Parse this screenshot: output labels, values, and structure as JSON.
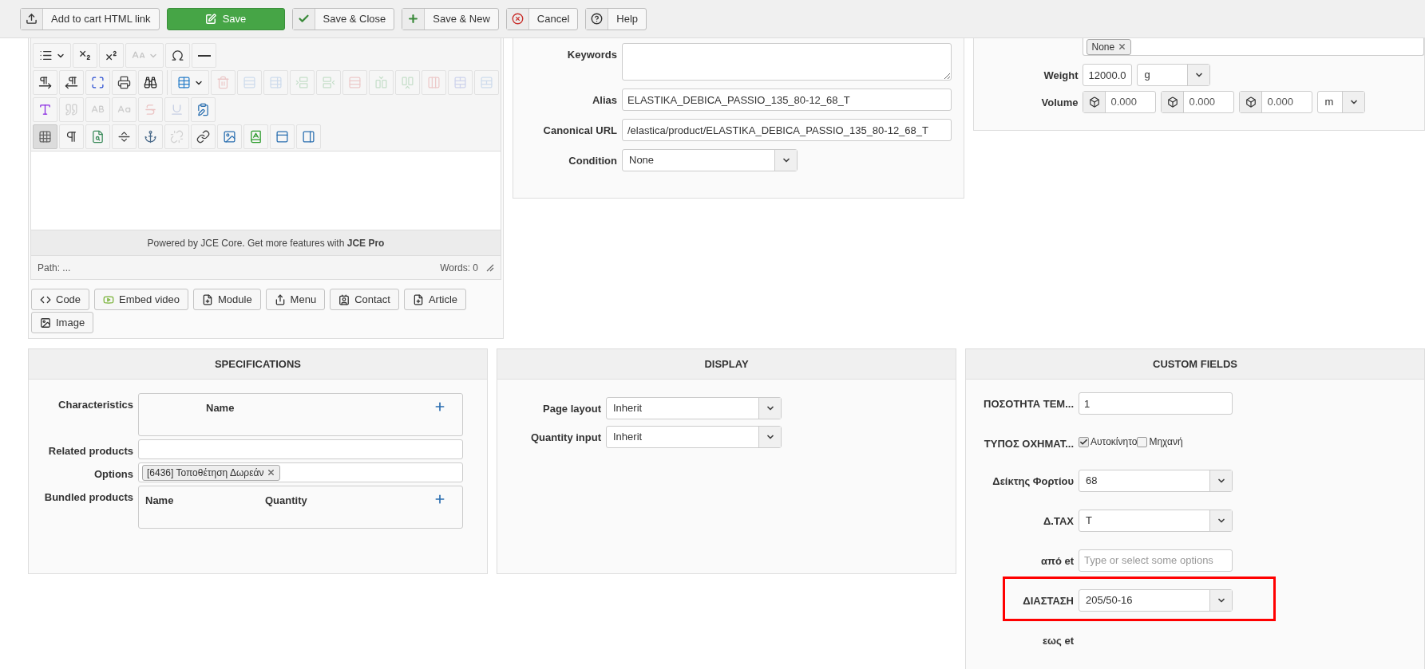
{
  "toolbar": {
    "buttons": [
      {
        "label": "Add to cart HTML link",
        "kind": "upload"
      },
      {
        "label": "Save",
        "kind": "save"
      },
      {
        "label": "Save & Close",
        "kind": "check"
      },
      {
        "label": "Save & New",
        "kind": "plus"
      },
      {
        "label": "Cancel",
        "kind": "cancel"
      },
      {
        "label": "Help",
        "kind": "help"
      }
    ]
  },
  "editor": {
    "toolbar_rows": [
      {
        "groups": [
          [
            {
              "kind": "bullet-list",
              "dropdown": true,
              "disabled": false,
              "selected": false
            },
            {
              "kind": "subscript",
              "disabled": false,
              "selected": false
            },
            {
              "kind": "superscript",
              "disabled": false,
              "selected": false
            },
            {
              "kind": "font-size",
              "dropdown": true,
              "disabled": true,
              "selected": false
            },
            {
              "kind": "special-char",
              "disabled": false,
              "selected": false
            },
            {
              "kind": "horizontal-rule",
              "disabled": false,
              "selected": false
            }
          ]
        ]
      },
      {
        "groups": [
          [
            {
              "kind": "ltr",
              "disabled": false,
              "selected": false
            },
            {
              "kind": "rtl",
              "disabled": false,
              "selected": false
            },
            {
              "kind": "fullscreen",
              "disabled": false,
              "selected": false
            },
            {
              "kind": "print",
              "disabled": false,
              "selected": false
            },
            {
              "kind": "search",
              "disabled": false,
              "selected": false
            }
          ],
          [
            {
              "kind": "table",
              "dropdown": true,
              "disabled": false,
              "selected": false
            },
            {
              "kind": "delete-table",
              "disabled": true,
              "selected": false
            },
            {
              "kind": "row-props",
              "disabled": true,
              "selected": false
            },
            {
              "kind": "cell-props",
              "disabled": true,
              "selected": false
            },
            {
              "kind": "row-before",
              "disabled": true,
              "selected": false
            },
            {
              "kind": "row-after",
              "disabled": true,
              "selected": false
            },
            {
              "kind": "delete-row",
              "disabled": true,
              "selected": false
            },
            {
              "kind": "col-before",
              "disabled": true,
              "selected": false
            },
            {
              "kind": "col-after",
              "disabled": true,
              "selected": false
            },
            {
              "kind": "delete-col",
              "disabled": true,
              "selected": false
            },
            {
              "kind": "merge-cells",
              "disabled": true,
              "selected": false
            },
            {
              "kind": "split-cells",
              "disabled": true,
              "selected": false
            }
          ]
        ]
      },
      {
        "groups": [
          [
            {
              "kind": "style",
              "disabled": false,
              "selected": false
            },
            {
              "kind": "quote",
              "disabled": true,
              "selected": false
            },
            {
              "kind": "abbr",
              "disabled": true,
              "selected": false
            },
            {
              "kind": "acronym",
              "disabled": true,
              "selected": false
            },
            {
              "kind": "del",
              "disabled": true,
              "selected": false
            },
            {
              "kind": "ins",
              "disabled": true,
              "selected": false
            },
            {
              "kind": "attributes",
              "disabled": false,
              "selected": false
            }
          ]
        ]
      },
      {
        "groups": [
          [
            {
              "kind": "visual-aid",
              "disabled": false,
              "selected": true
            },
            {
              "kind": "show-blocks",
              "disabled": false,
              "selected": false
            },
            {
              "kind": "preview",
              "disabled": false,
              "selected": false
            },
            {
              "kind": "page-break",
              "disabled": false,
              "selected": false
            },
            {
              "kind": "anchor",
              "disabled": false,
              "selected": false
            },
            {
              "kind": "unlink",
              "disabled": true,
              "selected": false
            },
            {
              "kind": "link",
              "disabled": false,
              "selected": false
            },
            {
              "kind": "image",
              "disabled": false,
              "selected": false
            },
            {
              "kind": "spellcheck",
              "disabled": false,
              "selected": false
            },
            {
              "kind": "read-more",
              "disabled": false,
              "selected": false
            },
            {
              "kind": "panel",
              "disabled": false,
              "selected": false
            }
          ]
        ]
      }
    ],
    "footer_note": "Powered by JCE Core. Get more features with **JCE Pro**",
    "path": "Path: ...",
    "word_count": "Words: 0",
    "buttons": [
      {
        "label": "Code",
        "kind": "code"
      },
      {
        "label": "Embed video",
        "kind": "video"
      },
      {
        "label": "Module",
        "kind": "module"
      },
      {
        "label": "Menu",
        "kind": "menu"
      },
      {
        "label": "Contact",
        "kind": "contact"
      },
      {
        "label": "Article",
        "kind": "article"
      },
      {
        "label": "Image",
        "kind": "image"
      }
    ]
  },
  "meta_panel": {
    "fields": [
      {
        "label": "Keywords",
        "kind": "textarea"
      },
      {
        "label": "Alias",
        "kind": "text",
        "value": "ELASTIKA_DEBICA_PASSIO_135_80-12_68_T"
      },
      {
        "label": "Canonical URL",
        "kind": "text",
        "value": "/elastica/product/ELASTIKA_DEBICA_PASSIO_135_80-12_68_T"
      },
      {
        "label": "Condition",
        "kind": "select",
        "value": "None"
      }
    ]
  },
  "shipping_panel": {
    "tags": [
      "None"
    ],
    "weight": {
      "label": "Weight",
      "value": "12000.0",
      "unit": "g"
    },
    "volume": {
      "label": "Volume",
      "values": [
        "0.000",
        "0.000",
        "0.000"
      ],
      "unit": "m"
    }
  },
  "specifications": {
    "title": "SPECIFICATIONS",
    "fields": [
      {
        "label": "Characteristics",
        "kind": "table",
        "columns": [
          "Name"
        ]
      },
      {
        "label": "Related products",
        "kind": "text"
      },
      {
        "label": "Options",
        "kind": "tags",
        "tags": [
          "[6436] Τοποθέτηση Δωρεάν"
        ]
      },
      {
        "label": "Bundled products",
        "kind": "table",
        "columns": [
          "Name",
          "Quantity"
        ]
      }
    ]
  },
  "display": {
    "title": "DISPLAY",
    "fields": [
      {
        "label": "Page layout",
        "kind": "select",
        "value": "Inherit"
      },
      {
        "label": "Quantity input",
        "kind": "select",
        "value": "Inherit"
      }
    ]
  },
  "custom_fields": {
    "title": "CUSTOM FIELDS",
    "fields": [
      {
        "label": "ΠΟΣΟΤΗΤΑ ΤΕΜ...",
        "kind": "text",
        "value": "1",
        "highlighted": false
      },
      {
        "label": "ΤΥΠΟΣ ΟΧΗΜΑΤ...",
        "kind": "checkboxes",
        "options": [
          {
            "label": "Αυτοκίνητο",
            "checked": true
          },
          {
            "label": "Μηχανή",
            "checked": false
          }
        ],
        "highlighted": false
      },
      {
        "label": "Δείκτης Φορτίου",
        "kind": "select",
        "value": "68",
        "highlighted": false
      },
      {
        "label": "Δ.ΤΑΧ",
        "kind": "select",
        "value": "T",
        "highlighted": false
      },
      {
        "label": "από et",
        "kind": "multiselect",
        "placeholder": "Type or select some options",
        "highlighted": false
      },
      {
        "label": "ΔΙΑΣΤΑΣΗ",
        "kind": "select",
        "value": "205/50-16",
        "highlighted": true
      },
      {
        "label": "εως et",
        "kind": "empty",
        "highlighted": false
      }
    ]
  }
}
